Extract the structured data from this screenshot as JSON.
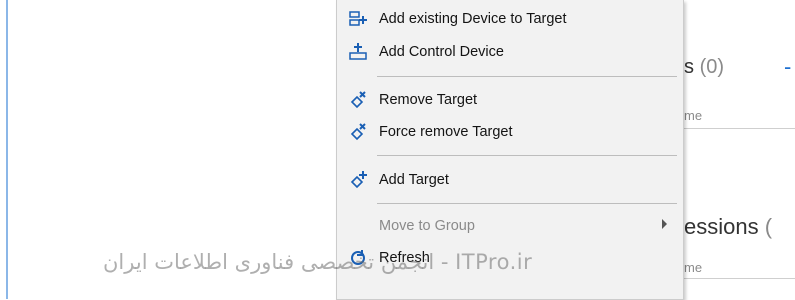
{
  "background": {
    "section1": {
      "title_fragment": "s",
      "count": "(0)",
      "column_fragment": "me"
    },
    "section2": {
      "title_fragment": "essions",
      "count": "(",
      "column_fragment": "me"
    },
    "accent_mark": "-"
  },
  "context_menu": {
    "items": [
      {
        "label": "Add existing Device to Target",
        "icon": "add-existing-device-icon",
        "enabled": true
      },
      {
        "label": "Add Control Device",
        "icon": "add-control-device-icon",
        "enabled": true
      },
      {
        "label": "Remove Target",
        "icon": "remove-target-icon",
        "enabled": true
      },
      {
        "label": "Force remove Target",
        "icon": "force-remove-target-icon",
        "enabled": true
      },
      {
        "label": "Add Target",
        "icon": "add-target-icon",
        "enabled": true
      },
      {
        "label": "Move to Group",
        "icon": "",
        "enabled": false,
        "has_submenu": true
      },
      {
        "label": "Refresh",
        "icon": "refresh-icon",
        "enabled": true
      }
    ]
  },
  "watermark": {
    "text": "انجمن تخصصی فناوری اطلاعات ایران - ITPro.ir"
  },
  "colors": {
    "accent": "#1e6fd0",
    "menu_bg": "#f2f2f2",
    "icon_blue": "#1a5fb4"
  }
}
